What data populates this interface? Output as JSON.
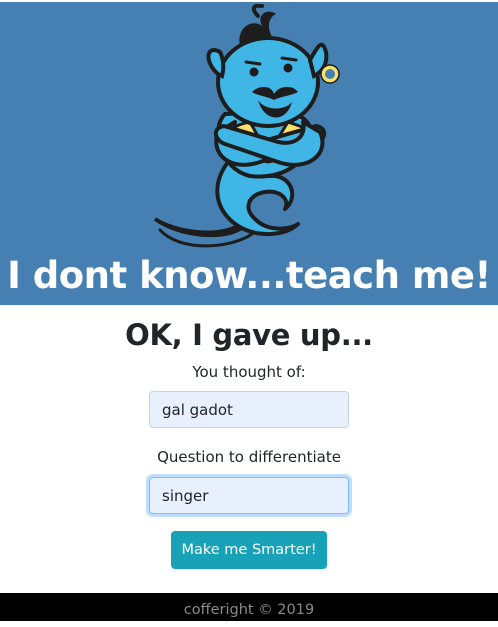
{
  "hero": {
    "title": "I dont know...teach me!",
    "background_color": "#4680b3",
    "mascot_icon": "genie-mascot-icon"
  },
  "main": {
    "heading": "OK, I gave up...",
    "thought_label": "You thought of:",
    "thought_value": "gal gadot",
    "question_label": "Question to differentiate",
    "question_value": "singer",
    "submit_label": "Make me Smarter!",
    "submit_color": "#17a2b8"
  },
  "footer": {
    "text": "cofferight © 2019"
  }
}
